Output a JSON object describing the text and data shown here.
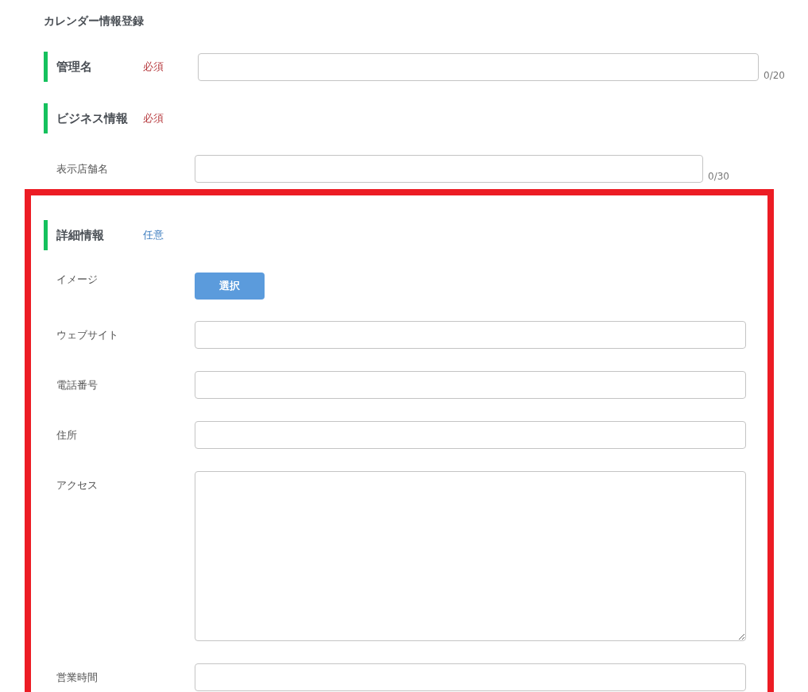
{
  "title": "カレンダー情報登録",
  "blocks": [
    {
      "kind": "section",
      "heading": "管理名",
      "tag": "必須",
      "required": true,
      "counter": "0/20"
    },
    {
      "kind": "section",
      "heading": "ビジネス情報",
      "tag": "必須",
      "required": true
    },
    {
      "kind": "text",
      "label": "表示店舗名",
      "counter": "0/30"
    }
  ],
  "highlighted_blocks": [
    {
      "kind": "section",
      "heading": "詳細情報",
      "tag": "任意",
      "required": false
    },
    {
      "kind": "button",
      "label": "イメージ",
      "button": "選択"
    },
    {
      "kind": "text",
      "label": "ウェブサイト"
    },
    {
      "kind": "text",
      "label": "電話番号"
    },
    {
      "kind": "text",
      "label": "住所"
    },
    {
      "kind": "textarea",
      "label": "アクセス"
    },
    {
      "kind": "text",
      "label": "営業時間"
    }
  ]
}
